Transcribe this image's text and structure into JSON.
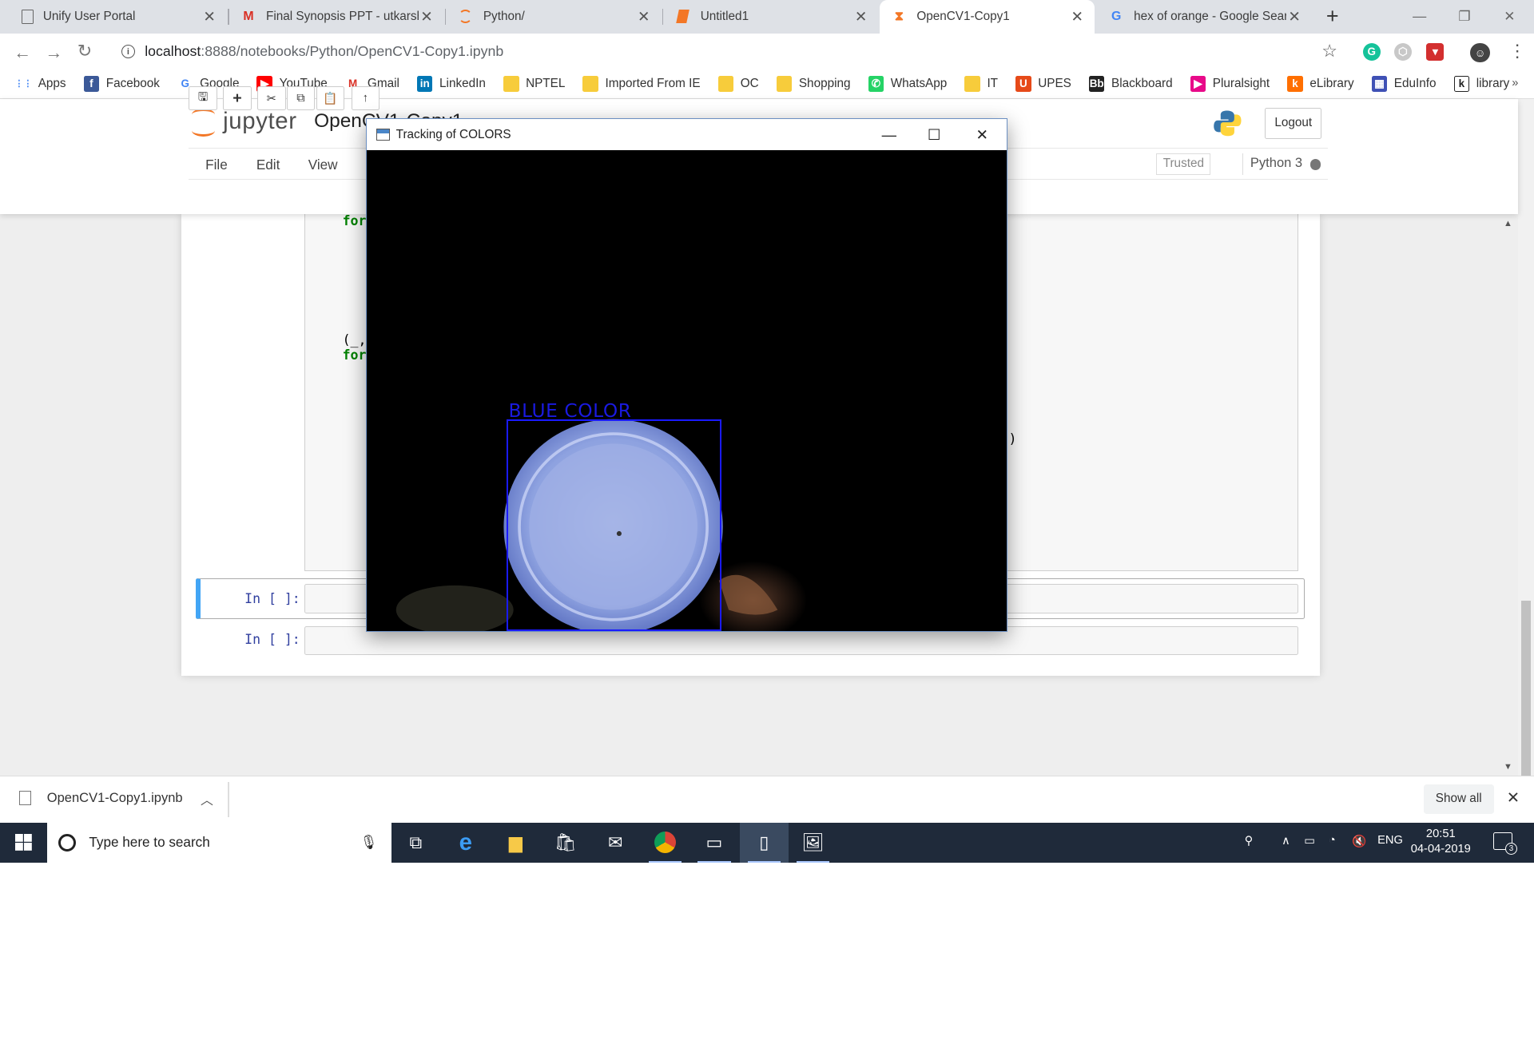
{
  "browser": {
    "tabs": [
      {
        "title": "Unify User Portal",
        "icon": "doc-icon"
      },
      {
        "title": "Final Synopsis PPT - utkarsh",
        "icon": "gmail-icon"
      },
      {
        "title": "Python/",
        "icon": "jupyter-icon"
      },
      {
        "title": "Untitled1",
        "icon": "jupyter-book-icon"
      },
      {
        "title": "OpenCV1-Copy1",
        "icon": "hourglass-icon"
      },
      {
        "title": "hex of orange - Google Search",
        "icon": "google-icon"
      }
    ],
    "active_tab": 4,
    "url_host": "localhost",
    "url_path": ":8888/notebooks/Python/OpenCV1-Copy1.ipynb",
    "bookmarks": [
      {
        "label": "Apps",
        "icon": "apps-grid-icon",
        "color": "#4285f4"
      },
      {
        "label": "Facebook",
        "icon": "facebook-icon",
        "color": "#3b5998"
      },
      {
        "label": "Google",
        "icon": "google-icon",
        "color": "#ffffff"
      },
      {
        "label": "YouTube",
        "icon": "youtube-icon",
        "color": "#ff0000"
      },
      {
        "label": "Gmail",
        "icon": "gmail-icon",
        "color": "#ffffff"
      },
      {
        "label": "LinkedIn",
        "icon": "linkedin-icon",
        "color": "#0077b5"
      },
      {
        "label": "NPTEL",
        "icon": "folder-icon",
        "color": "#f7cc3b"
      },
      {
        "label": "Imported From IE",
        "icon": "folder-icon",
        "color": "#f7cc3b"
      },
      {
        "label": "OC",
        "icon": "folder-icon",
        "color": "#f7cc3b"
      },
      {
        "label": "Shopping",
        "icon": "folder-icon",
        "color": "#f7cc3b"
      },
      {
        "label": "WhatsApp",
        "icon": "whatsapp-icon",
        "color": "#25d366"
      },
      {
        "label": "IT",
        "icon": "folder-icon",
        "color": "#f7cc3b"
      },
      {
        "label": "UPES",
        "icon": "upes-icon",
        "color": "#e64a19"
      },
      {
        "label": "Blackboard",
        "icon": "blackboard-icon",
        "color": "#222222"
      },
      {
        "label": "Pluralsight",
        "icon": "pluralsight-icon",
        "color": "#e80a89"
      },
      {
        "label": "eLibrary",
        "icon": "elibrary-icon",
        "color": "#ff6f00"
      },
      {
        "label": "EduInfo",
        "icon": "eduinfo-icon",
        "color": "#3f51b5"
      },
      {
        "label": "library",
        "icon": "library-icon",
        "color": "#222222"
      }
    ],
    "more": "»"
  },
  "jupyter": {
    "logo_text": "jupyter",
    "notebook_title": "OpenCV1-Copy1",
    "logout": "Logout",
    "menus": [
      "File",
      "Edit",
      "View"
    ],
    "trusted": "Trusted",
    "kernel": "Python 3",
    "toolbar_icons": [
      "save-icon",
      "plus-icon",
      "scissors-icon",
      "copy-icon",
      "paste-icon"
    ],
    "code_fragments": [
      {
        "text": "for",
        "kw": true
      },
      {
        "text": "(_,",
        "kw": false
      },
      {
        "text": "for",
        "kw": true
      },
      {
        "text": ")",
        "kw": false
      }
    ],
    "empty_cells": [
      {
        "prompt": "In [ ]:"
      },
      {
        "prompt": "In [ ]:"
      }
    ]
  },
  "cv_window": {
    "title": "Tracking of COLORS",
    "label": "BLUE COLOR",
    "box_color": "#1a1aff"
  },
  "downloads": {
    "file": "OpenCV1-Copy1.ipynb",
    "show_all": "Show all"
  },
  "taskbar": {
    "search_placeholder": "Type here to search",
    "lang": "ENG",
    "time": "20:51",
    "date": "04-04-2019",
    "notifications": "3"
  }
}
